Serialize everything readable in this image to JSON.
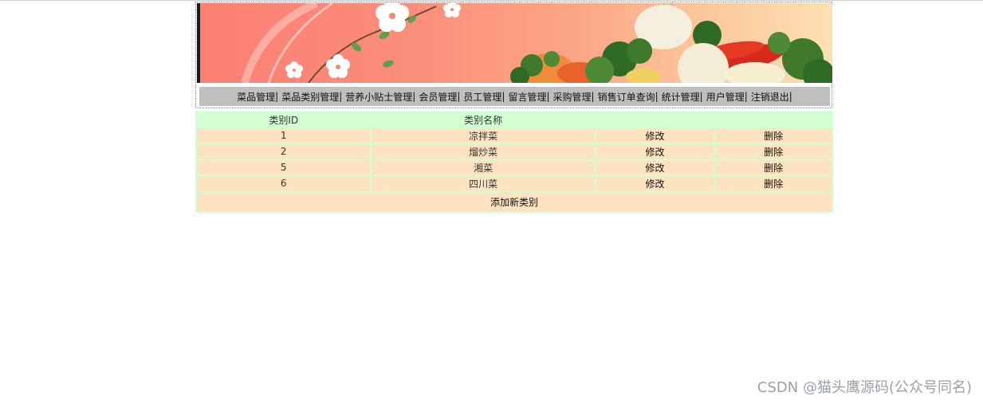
{
  "nav": {
    "items": [
      {
        "label": "菜品管理",
        "sep": "|"
      },
      {
        "label": "菜品类别管理",
        "sep": "|"
      },
      {
        "label": "营养小贴士管理",
        "sep": "|"
      },
      {
        "label": "会员管理",
        "sep": "|"
      },
      {
        "label": "员工管理",
        "sep": "|"
      },
      {
        "label": "留言管理",
        "sep": "|"
      },
      {
        "label": "采购管理",
        "sep": "|"
      },
      {
        "label": "销售订单查询",
        "sep": "|"
      },
      {
        "label": "统计管理",
        "sep": "|"
      },
      {
        "label": "用户管理",
        "sep": "|"
      },
      {
        "label": "注销退出",
        "sep": "|"
      }
    ]
  },
  "table": {
    "headers": {
      "id": "类别ID",
      "name": "类别名称"
    },
    "rows": [
      {
        "id": "1",
        "name": "凉拌菜",
        "edit": "修改",
        "delete": "删除"
      },
      {
        "id": "2",
        "name": "熘炒菜",
        "edit": "修改",
        "delete": "删除"
      },
      {
        "id": "5",
        "name": "湘菜",
        "edit": "修改",
        "delete": "删除"
      },
      {
        "id": "6",
        "name": "四川菜",
        "edit": "修改",
        "delete": "删除"
      }
    ],
    "add_label": "添加新类别"
  },
  "watermark": "CSDN @猫头鹰源码(公众号同名)",
  "colors": {
    "nav_bg": "#bfbfbf",
    "table_border": "#d3fdd3",
    "cell_bg": "#fde3bf",
    "banner_start": "#fb7f73",
    "banner_end": "#fde0b4"
  }
}
